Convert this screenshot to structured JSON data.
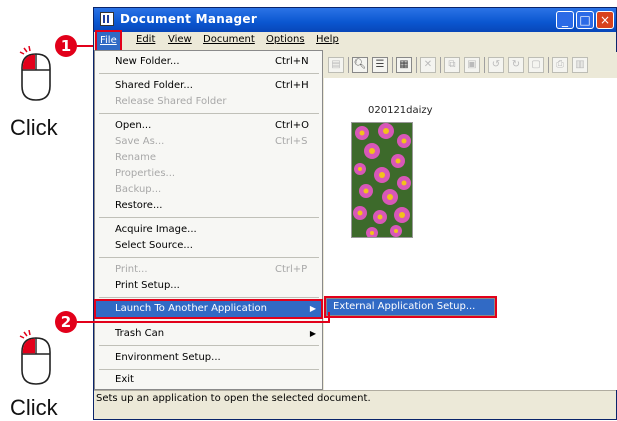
{
  "instructions": {
    "step1_number": "1",
    "step2_number": "2",
    "step1_label": "Click",
    "step2_label": "Click"
  },
  "window": {
    "title": "Document Manager",
    "buttons": {
      "minimize": "_",
      "maximize": "□",
      "close": "×"
    }
  },
  "menubar": [
    "File",
    "Edit",
    "View",
    "Document",
    "Options",
    "Help"
  ],
  "file_menu": [
    {
      "label": "New Folder...",
      "shortcut": "Ctrl+N",
      "disabled": false
    },
    {
      "label": "Shared Folder...",
      "shortcut": "Ctrl+H",
      "disabled": false
    },
    {
      "label": "Release Shared Folder",
      "shortcut": "",
      "disabled": true
    },
    {
      "label": "Open...",
      "shortcut": "Ctrl+O",
      "disabled": false
    },
    {
      "label": "Save As...",
      "shortcut": "Ctrl+S",
      "disabled": true
    },
    {
      "label": "Rename",
      "shortcut": "",
      "disabled": true
    },
    {
      "label": "Properties...",
      "shortcut": "",
      "disabled": true
    },
    {
      "label": "Backup...",
      "shortcut": "",
      "disabled": true
    },
    {
      "label": "Restore...",
      "shortcut": "",
      "disabled": false
    },
    {
      "label": "Acquire Image...",
      "shortcut": "",
      "disabled": false
    },
    {
      "label": "Select Source...",
      "shortcut": "",
      "disabled": false
    },
    {
      "label": "Print...",
      "shortcut": "Ctrl+P",
      "disabled": true
    },
    {
      "label": "Print Setup...",
      "shortcut": "",
      "disabled": false
    },
    {
      "label": "Launch To Another Application",
      "shortcut": "",
      "disabled": false
    },
    {
      "label": "Trash Can",
      "shortcut": "",
      "disabled": false
    },
    {
      "label": "Environment Setup...",
      "shortcut": "",
      "disabled": false
    },
    {
      "label": "Exit",
      "shortcut": "",
      "disabled": false
    }
  ],
  "submenu": {
    "label": "External Application Setup..."
  },
  "document": {
    "name": "020121daizy"
  },
  "status": "Sets up an application to open the selected document.",
  "colors": {
    "accent": "#e2001a",
    "selection": "#316ac5",
    "titlebar": "#0a56d0"
  }
}
